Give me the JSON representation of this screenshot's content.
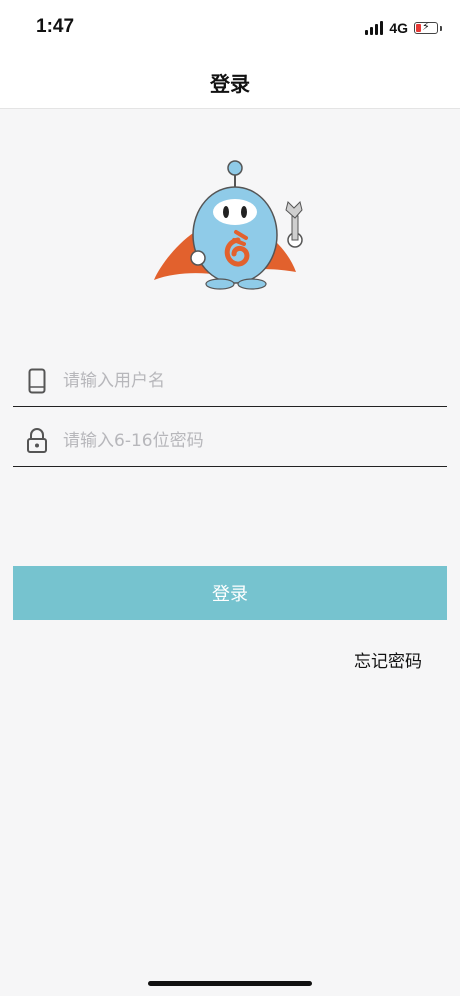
{
  "status_bar": {
    "time": "1:47",
    "network": "4G",
    "battery_level": 0.15,
    "battery_color": "#e53935"
  },
  "nav": {
    "title": "登录"
  },
  "mascot": {
    "icon": "robot-superhero-mascot"
  },
  "form": {
    "username": {
      "placeholder": "请输入用户名",
      "value": "",
      "icon": "phone-icon"
    },
    "password": {
      "placeholder": "请输入6-16位密码",
      "value": "",
      "icon": "lock-icon"
    },
    "login_label": "登录",
    "login_color": "#76c3cf",
    "forgot_label": "忘记密码"
  }
}
